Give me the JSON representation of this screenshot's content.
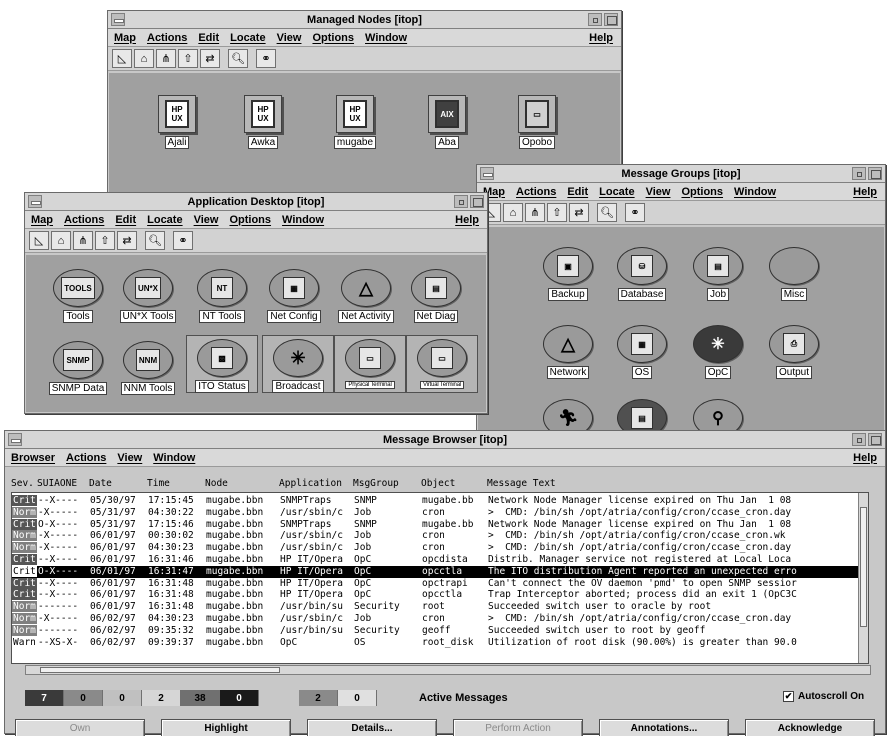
{
  "managed_nodes": {
    "title": "Managed Nodes [itop]",
    "menu": [
      "Map",
      "Actions",
      "Edit",
      "Locate",
      "View",
      "Options",
      "Window"
    ],
    "help": "Help",
    "nodes": [
      {
        "label": "Ajali",
        "os": "HP\nUX"
      },
      {
        "label": "Awka",
        "os": "HP\nUX"
      },
      {
        "label": "mugabe",
        "os": "HP\nUX"
      },
      {
        "label": "Aba",
        "os": "AIX"
      },
      {
        "label": "Opobo",
        "os": ""
      }
    ]
  },
  "message_groups": {
    "title": "Message Groups [itop]",
    "menu": [
      "Map",
      "Actions",
      "Edit",
      "Locate",
      "View",
      "Options",
      "Window"
    ],
    "help": "Help",
    "groups": [
      {
        "label": "Backup",
        "icon": "backup-icon"
      },
      {
        "label": "Database",
        "icon": "database-icon"
      },
      {
        "label": "Job",
        "icon": "job-icon"
      },
      {
        "label": "Misc",
        "icon": "misc-icon"
      },
      {
        "label": "Network",
        "icon": "network-icon"
      },
      {
        "label": "OS",
        "icon": "os-icon"
      },
      {
        "label": "OpC",
        "icon": "opc-icon"
      },
      {
        "label": "Output",
        "icon": "output-icon"
      }
    ]
  },
  "app_desktop": {
    "title": "Application Desktop [itop]",
    "menu": [
      "Map",
      "Actions",
      "Edit",
      "Locate",
      "View",
      "Options",
      "Window"
    ],
    "help": "Help",
    "apps": [
      {
        "label": "Tools",
        "glyph": "TOOLS"
      },
      {
        "label": "UN*X Tools",
        "glyph": "UN*X"
      },
      {
        "label": "NT Tools",
        "glyph": "NT"
      },
      {
        "label": "Net Config",
        "glyph": "▦"
      },
      {
        "label": "Net Activity",
        "glyph": "△"
      },
      {
        "label": "Net Diag",
        "glyph": "▤"
      },
      {
        "label": "SNMP Data",
        "glyph": "SNMP"
      },
      {
        "label": "NNM Tools",
        "glyph": "NNM"
      },
      {
        "label": "ITO Status",
        "glyph": "▩"
      },
      {
        "label": "Broadcast",
        "glyph": "✳"
      },
      {
        "label": "Physical Terminal",
        "glyph": "▭"
      },
      {
        "label": "Virtual Terminal",
        "glyph": "▭"
      }
    ]
  },
  "message_browser": {
    "title": "Message Browser [itop]",
    "menu": [
      "Browser",
      "Actions",
      "View",
      "Window"
    ],
    "help": "Help",
    "headers": {
      "sev": "Sev.",
      "flags": "SUIAONE",
      "date": "Date",
      "time": "Time",
      "node": "Node",
      "app": "Application",
      "group": "MsgGroup",
      "object": "Object",
      "text": "Message Text"
    },
    "rows": [
      {
        "sev": "Crit",
        "flags": "--X----",
        "date": "05/30/97",
        "time": "17:15:45",
        "node": "mugabe.bbn",
        "app": "SNMPTraps",
        "group": "SNMP",
        "object": "mugabe.bb",
        "text": "Network Node Manager license expired on Thu Jan  1 08"
      },
      {
        "sev": "Norm",
        "flags": "-X-----",
        "date": "05/31/97",
        "time": "04:30:22",
        "node": "mugabe.bbn",
        "app": "/usr/sbin/c",
        "group": "Job",
        "object": "cron",
        "text": ">  CMD: /bin/sh /opt/atria/config/cron/ccase_cron.day"
      },
      {
        "sev": "Crit",
        "flags": "O-X----",
        "date": "05/31/97",
        "time": "17:15:46",
        "node": "mugabe.bbn",
        "app": "SNMPTraps",
        "group": "SNMP",
        "object": "mugabe.bb",
        "text": "Network Node Manager license expired on Thu Jan  1 08"
      },
      {
        "sev": "Norm",
        "flags": "-X-----",
        "date": "06/01/97",
        "time": "00:30:02",
        "node": "mugabe.bbn",
        "app": "/usr/sbin/c",
        "group": "Job",
        "object": "cron",
        "text": ">  CMD: /bin/sh /opt/atria/config/cron/ccase_cron.wk"
      },
      {
        "sev": "Norm",
        "flags": "-X-----",
        "date": "06/01/97",
        "time": "04:30:23",
        "node": "mugabe.bbn",
        "app": "/usr/sbin/c",
        "group": "Job",
        "object": "cron",
        "text": ">  CMD: /bin/sh /opt/atria/config/cron/ccase_cron.day"
      },
      {
        "sev": "Crit",
        "flags": "--X----",
        "date": "06/01/97",
        "time": "16:31:46",
        "node": "mugabe.bbn",
        "app": "HP IT/Opera",
        "group": "OpC",
        "object": "opcdista",
        "text": "Distrib. Manager service not registered at Local Loca"
      },
      {
        "sev": "Crit",
        "flags": "O-X----",
        "date": "06/01/97",
        "time": "16:31:47",
        "node": "mugabe.bbn",
        "app": "HP IT/Opera",
        "group": "OpC",
        "object": "opcctla",
        "text": "The ITO distribution Agent reported an unexpected erro"
      },
      {
        "sev": "Crit",
        "flags": "--X----",
        "date": "06/01/97",
        "time": "16:31:48",
        "node": "mugabe.bbn",
        "app": "HP IT/Opera",
        "group": "OpC",
        "object": "opctrapi",
        "text": "Can't connect the OV daemon 'pmd' to open SNMP sessior"
      },
      {
        "sev": "Crit",
        "flags": "--X----",
        "date": "06/01/97",
        "time": "16:31:48",
        "node": "mugabe.bbn",
        "app": "HP IT/Opera",
        "group": "OpC",
        "object": "opcctla",
        "text": "Trap Interceptor aborted; process did an exit 1 (OpC3C"
      },
      {
        "sev": "Norm",
        "flags": "-------",
        "date": "06/01/97",
        "time": "16:31:48",
        "node": "mugabe.bbn",
        "app": "/usr/bin/su",
        "group": "Security",
        "object": "root",
        "text": "Succeeded switch user to oracle by root"
      },
      {
        "sev": "Norm",
        "flags": "-X-----",
        "date": "06/02/97",
        "time": "04:30:23",
        "node": "mugabe.bbn",
        "app": "/usr/sbin/c",
        "group": "Job",
        "object": "cron",
        "text": ">  CMD: /bin/sh /opt/atria/config/cron/ccase_cron.day"
      },
      {
        "sev": "Norm",
        "flags": "-------",
        "date": "06/02/97",
        "time": "09:35:32",
        "node": "mugabe.bbn",
        "app": "/usr/bin/su",
        "group": "Security",
        "object": "geoff",
        "text": "Succeeded switch user to root by geoff"
      },
      {
        "sev": "Warn",
        "flags": "--XS-X-",
        "date": "06/02/97",
        "time": "09:39:37",
        "node": "mugabe.bbn",
        "app": "OpC",
        "group": "OS",
        "object": "root_disk",
        "text": "Utilization of root disk (90.00%) is greater than 90.0"
      }
    ],
    "selected_row": 6,
    "counts": [
      {
        "value": "7",
        "bg": "#3a3a3a",
        "fg": "#ffffff"
      },
      {
        "value": "0",
        "bg": "#8a8a8a",
        "fg": "#000000"
      },
      {
        "value": "0",
        "bg": "#c0c0c0",
        "fg": "#000000"
      },
      {
        "value": "2",
        "bg": "#d6d6d6",
        "fg": "#000000"
      },
      {
        "value": "38",
        "bg": "#707070",
        "fg": "#000000"
      },
      {
        "value": "0",
        "bg": "#1a1a1a",
        "fg": "#ffffff"
      }
    ],
    "counts2": [
      {
        "value": "2",
        "bg": "#8a8a8a",
        "fg": "#000000"
      },
      {
        "value": "0",
        "bg": "#e0e0e0",
        "fg": "#000000"
      }
    ],
    "active_label": "Active Messages",
    "autoscroll_label": "Autoscroll On",
    "autoscroll_checked": true,
    "buttons": {
      "own": "Own",
      "highlight": "Highlight",
      "details": "Details...",
      "perform": "Perform Action",
      "annotations": "Annotations...",
      "acknowledge": "Acknowledge"
    }
  }
}
